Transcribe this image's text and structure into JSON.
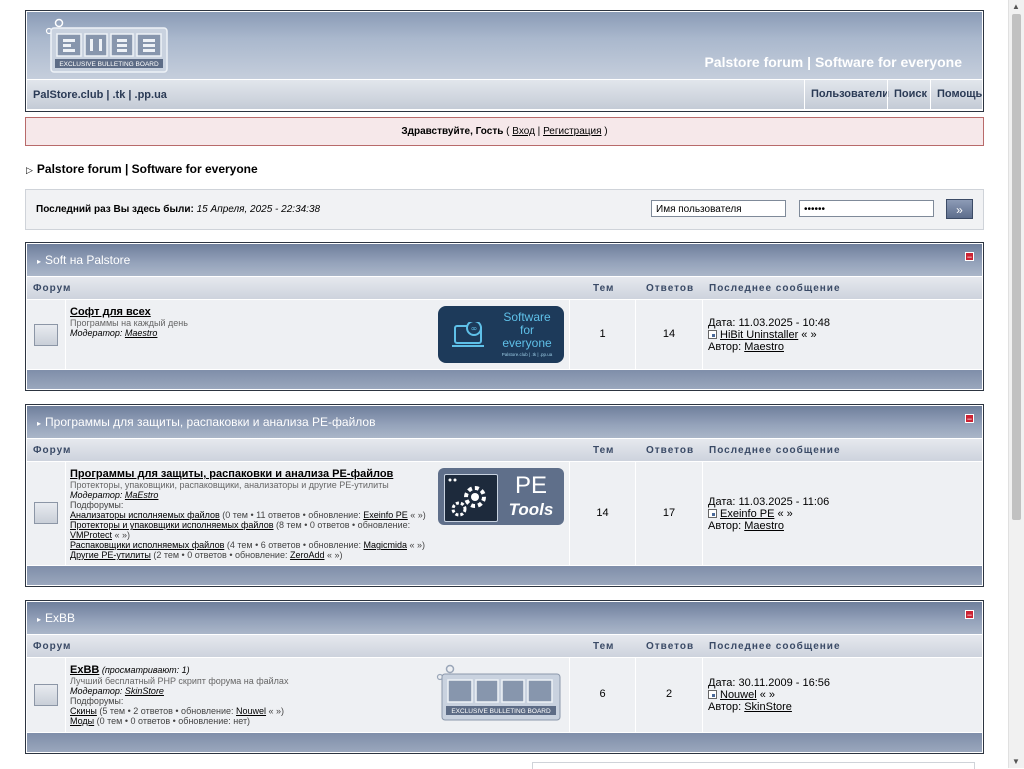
{
  "header": {
    "banner_title": "Palstore forum | Software for everyone",
    "nav_left": "PalStore.club | .tk | .pp.ua",
    "nav_users": "Пользователи",
    "nav_search": "Поиск",
    "nav_help": "Помощь"
  },
  "welcome": {
    "greeting": "Здравствуйте, Гость",
    "open": " ( ",
    "login": "Вход",
    "sep": " | ",
    "register": "Регистрация",
    "close": " )"
  },
  "breadcrumb": {
    "arrow": "▷",
    "title": "Palstore forum | Software for everyone"
  },
  "login": {
    "last_visit_label": "Последний раз Вы здесь были:",
    "last_visit_value": "15 Апреля, 2025 - 22:34:38",
    "username_placeholder": "Имя пользователя",
    "password_value": "••••••",
    "go": "»"
  },
  "columns": {
    "forum": "Форум",
    "topics": "Тем",
    "replies": "Ответов",
    "last": "Последнее сообщение"
  },
  "categories": [
    {
      "title": "Soft на Palstore",
      "forum": {
        "name": "Софт для всех",
        "desc": "Программы на каждый день",
        "mod_label": "Модератор:",
        "mod": "Maestro",
        "topics": "1",
        "replies": "14",
        "date": "Дата: 11.03.2025 - 10:48",
        "topic": "HiBit Uninstaller",
        "topic_suffix": " « »",
        "author_label": "Автор:",
        "author": "Maestro"
      },
      "banner": {
        "line1": "Software",
        "line2": "for",
        "line3": "everyone",
        "small": "Palstore.club | .tk | .pp.ua"
      }
    },
    {
      "title": "Программы для защиты, распаковки и анализа PE-файлов",
      "forum": {
        "name": "Программы для защиты, распаковки и анализа PE-файлов",
        "desc": "Протекторы, упаковщики, распаковщики, анализаторы и другие PE-утилиты",
        "mod_label": "Модератор:",
        "mod": "MaEstro",
        "sub_label": "Подфорумы:",
        "subs": [
          {
            "name": "Анализаторы исполняемых файлов",
            "info": " (0 тем • 11 ответов • обновление: ",
            "upd": "Exeinfo PE",
            "end": " « »)"
          },
          {
            "name": "Протекторы и упаковщики исполняемых файлов",
            "info": " (8 тем • 0 ответов • обновление:",
            "upd": "VMProtect",
            "end": " « »)"
          },
          {
            "name": "Распаковщики исполняемых файлов",
            "info": " (4 тем • 6 ответов • обновление: ",
            "upd": "Magicmida",
            "end": " « »)"
          },
          {
            "name": "Другие PE-утилиты",
            "info": " (2 тем • 0 ответов • обновление: ",
            "upd": "ZeroAdd",
            "end": " « »)"
          }
        ],
        "topics": "14",
        "replies": "17",
        "date": "Дата: 11.03.2025 - 11:06",
        "topic": "Exeinfo PE",
        "topic_suffix": " « »",
        "author_label": "Автор:",
        "author": "Maestro"
      },
      "banner": {
        "line1": "PE",
        "line2": "Tools"
      }
    },
    {
      "title": "ExBB",
      "forum": {
        "name": "ExBB",
        "viewing": " (просматривают: 1)",
        "desc": "Лучший бесплатный PHP скрипт форума на файлах",
        "mod_label": "Модератор:",
        "mod": "SkinStore",
        "sub_label": "Подфорумы:",
        "subs": [
          {
            "name": "Скины",
            "info": " (5 тем • 2 ответов • обновление: ",
            "upd": "Nouwel",
            "end": " « »)"
          },
          {
            "name": "Моды",
            "info": " (0 тем • 0 ответов • обновление: нет)",
            "upd": "",
            "end": ""
          }
        ],
        "topics": "6",
        "replies": "2",
        "date": "Дата: 30.11.2009 - 16:56",
        "topic": "Nouwel",
        "topic_suffix": " « »",
        "author_label": "Автор:",
        "author": "SkinStore"
      },
      "banner": {
        "logo_text": "ExBB",
        "small": "EXCLUSIVE BULLETING BOARD"
      }
    }
  ],
  "logo": {
    "text": "ExBB",
    "small": "EXCLUSIVE BULLETING BOARD"
  },
  "colors": {
    "accent": "#8a9bb6",
    "welcome_bg": "#f6e8ea",
    "welcome_border": "#b86a6a",
    "banner_dark": "#1d3a5a"
  }
}
